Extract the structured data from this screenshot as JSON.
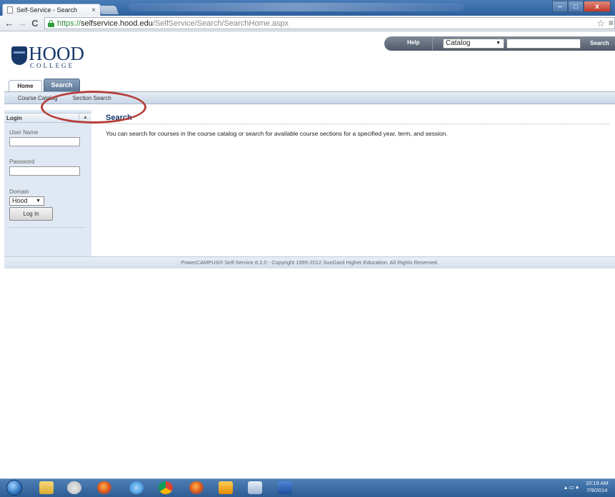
{
  "browser": {
    "tab_title": "Self-Service - Search",
    "tab_close": "×",
    "url_scheme": "https://",
    "url_host": "selfservice.hood.edu",
    "url_path": "/SelfService/Search/SearchHome.aspx"
  },
  "logo": {
    "name": "HOOD",
    "sub": "COLLEGE"
  },
  "top_search": {
    "help_label": "Help",
    "catalog_selected": "Catalog",
    "query_value": "",
    "search_label": "Search"
  },
  "tabs": [
    {
      "label": "Home"
    },
    {
      "label": "Search"
    }
  ],
  "subnav": [
    {
      "label": "Course Catalog"
    },
    {
      "label": "Section Search"
    }
  ],
  "login": {
    "title": "Login",
    "username_label": "User Name",
    "password_label": "Password",
    "domain_label": "Domain",
    "domain_selected": "Hood",
    "button_label": "Log In"
  },
  "main": {
    "title": "Search",
    "description": "You can search for courses in the course catalog or search for available course sections for a specified year, term, and session."
  },
  "footer": {
    "text": "PowerCAMPUS® Self-Service 8.2.0 - Copyright 1995-2012 SunGard Higher Education. All Rights Reserved."
  },
  "taskbar": {
    "time": "10:19 AM",
    "date": "7/9/2014"
  },
  "colors": {
    "brand": "#17396b",
    "annotation": "#b5403a"
  }
}
